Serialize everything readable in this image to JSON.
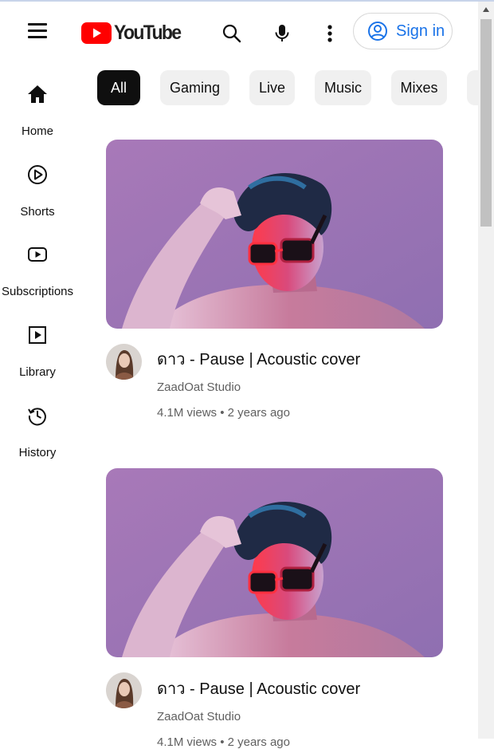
{
  "header": {
    "logo_text": "YouTube",
    "menu_icon": "hamburger-menu-icon",
    "search_icon": "search-icon",
    "mic_icon": "microphone-icon",
    "more_icon": "more-vertical-icon",
    "signin_label": "Sign in",
    "accent": "#1a73e8",
    "brand_red": "#ff0000"
  },
  "sidebar": {
    "items": [
      {
        "label": "Home",
        "icon": "home-icon"
      },
      {
        "label": "Shorts",
        "icon": "shorts-icon"
      },
      {
        "label": "Subscriptions",
        "icon": "subscriptions-icon"
      },
      {
        "label": "Library",
        "icon": "library-icon"
      },
      {
        "label": "History",
        "icon": "history-icon"
      }
    ]
  },
  "chips": [
    {
      "label": "All",
      "active": true
    },
    {
      "label": "Gaming"
    },
    {
      "label": "Live"
    },
    {
      "label": "Music"
    },
    {
      "label": "Mixes"
    }
  ],
  "videos": [
    {
      "title": "ดาว - Pause | Acoustic cover",
      "channel": "ZaadOat Studio",
      "meta": "4.1M views • 2 years ago"
    },
    {
      "title": "ดาว - Pause | Acoustic cover",
      "channel": "ZaadOat Studio",
      "meta": "4.1M views • 2 years ago"
    }
  ]
}
